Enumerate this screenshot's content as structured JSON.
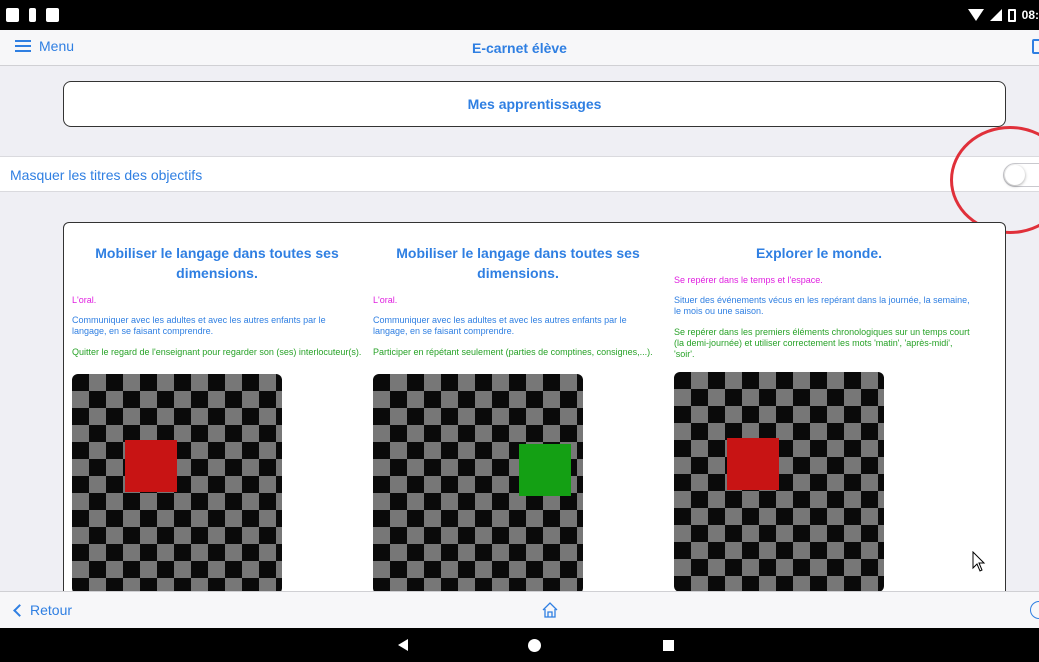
{
  "navbar": {
    "menu_label": "Menu",
    "title": "E-carnet élève"
  },
  "section": {
    "label": "Mes apprentissages"
  },
  "toggle": {
    "label": "Masquer les titres des objectifs",
    "checked": false
  },
  "columns": [
    {
      "title": "Mobiliser le langage dans toutes ses dimensions.",
      "domain": "L'oral.",
      "objective": "Communiquer avec les adultes et avec les autres enfants par le langage, en se faisant comprendre.",
      "item": "Quitter le regard de l'enseignant pour regarder son (ses) interlocuteur(s).",
      "status_color": "#c81414"
    },
    {
      "title": "Mobiliser le langage dans toutes ses dimensions.",
      "domain": "L'oral.",
      "objective": "Communiquer avec les adultes et avec les autres enfants par le langage, en se faisant comprendre.",
      "item": "Participer en répétant seulement (parties de comptines, consignes,...).",
      "status_color": "#14a014"
    },
    {
      "title": "Explorer le monde.",
      "domain": "Se repérer dans le temps et l'espace.",
      "objective": "Situer des événements vécus en les repérant dans la journée, la semaine, le mois ou une saison.",
      "item": "Se repérer dans les premiers éléments chronologiques sur un temps court (la demi-journée) et utiliser correctement les mots 'matin', 'après-midi', 'soir'.",
      "status_color": "#c81414"
    }
  ],
  "toolbar": {
    "back_label": "Retour"
  },
  "statusbar": {
    "time": "08:"
  },
  "colors": {
    "accent": "#2f7fe2",
    "domain": "#e020e0",
    "item": "#27a227",
    "highlight": "#e0303a"
  }
}
